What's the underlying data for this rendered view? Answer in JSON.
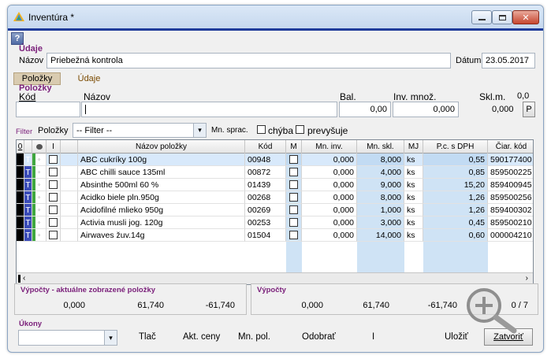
{
  "window": {
    "title": "Inventúra *",
    "help": "?"
  },
  "udaje_section": {
    "title": "Údaje",
    "nazov_label": "Názov",
    "nazov_value": "Priebežná kontrola",
    "datum_label": "Dátum",
    "datum_value": "23.05.2017"
  },
  "tabs": [
    {
      "label": "Položky",
      "active": true
    },
    {
      "label": "Údaje",
      "active": false
    }
  ],
  "polozky_section": {
    "title": "Položky",
    "kod_label": "Kód",
    "nazov_label": "Názov",
    "bal_label": "Bal.",
    "bal_value": "0,00",
    "inv_mnoz_label": "Inv. množ.",
    "inv_mnoz_value": "0,000",
    "skl_m_label": "Skl.m.",
    "skl_m_value": "0,0",
    "skl_m_value2": "0,000",
    "p_button": "P"
  },
  "filter": {
    "label": "Filter",
    "polozky_label": "Položky",
    "select_value": "-- Filter --",
    "mn_sprac_label": "Mn. sprac.",
    "chyba_label": "chýba",
    "prevysuje_label": "prevyšuje"
  },
  "grid": {
    "columns": [
      "0",
      "",
      "",
      "I",
      "Názov položky",
      "Kód",
      "M",
      "Mn. inv.",
      "Mn. skl.",
      "MJ",
      "P.c. s DPH",
      "Čiar. kód"
    ],
    "rows": [
      {
        "t": "T",
        "name": "ABC cukríky 100g",
        "kod": "00948",
        "mn_inv": "0,000",
        "mn_skl": "8,000",
        "mj": "ks",
        "pc": "0,55",
        "ciar": "590177400"
      },
      {
        "t": "T",
        "name": "ABC chilli sauce 135ml",
        "kod": "00872",
        "mn_inv": "0,000",
        "mn_skl": "4,000",
        "mj": "ks",
        "pc": "0,85",
        "ciar": "859500225"
      },
      {
        "t": "T",
        "name": "Absinthe 500ml 60 %",
        "kod": "01439",
        "mn_inv": "0,000",
        "mn_skl": "9,000",
        "mj": "ks",
        "pc": "15,20",
        "ciar": "859400945"
      },
      {
        "t": "T",
        "name": "Acidko biele pln.950g",
        "kod": "00268",
        "mn_inv": "0,000",
        "mn_skl": "8,000",
        "mj": "ks",
        "pc": "1,26",
        "ciar": "859500256"
      },
      {
        "t": "T",
        "name": "Acidofilné mlieko 950g",
        "kod": "00269",
        "mn_inv": "0,000",
        "mn_skl": "1,000",
        "mj": "ks",
        "pc": "1,26",
        "ciar": "859400302"
      },
      {
        "t": "T",
        "name": "Activia musli jog. 120g",
        "kod": "00253",
        "mn_inv": "0,000",
        "mn_skl": "3,000",
        "mj": "ks",
        "pc": "0,45",
        "ciar": "859500210"
      },
      {
        "t": "T",
        "name": "Airwaves žuv.14g",
        "kod": "01504",
        "mn_inv": "0,000",
        "mn_skl": "14,000",
        "mj": "ks",
        "pc": "0,60",
        "ciar": "000004210"
      }
    ]
  },
  "summary_left": {
    "title": "Výpočty - aktuálne zobrazené položky",
    "v1": "0,000",
    "v2": "61,740",
    "v3": "-61,740"
  },
  "summary_right": {
    "title": "Výpočty",
    "v1": "0,000",
    "v2": "61,740",
    "v3": "-61,740",
    "count": "0 / 7"
  },
  "ukony": {
    "title": "Úkony",
    "tlac": "Tlač",
    "akt_ceny": "Akt. ceny",
    "mn_pol": "Mn. pol.",
    "odobrat": "Odobrať",
    "i": "I",
    "ulozit": "Uložiť",
    "zatvorit": "Zatvoriť"
  }
}
